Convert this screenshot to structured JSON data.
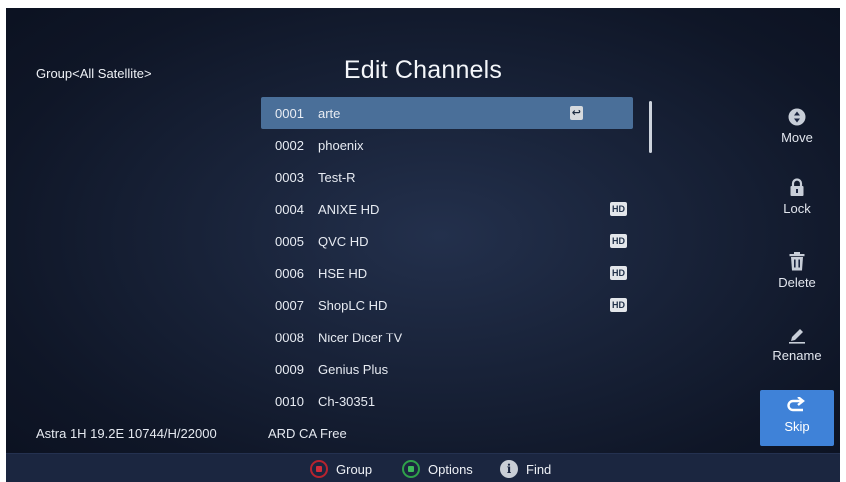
{
  "header": {
    "group": "Group<All Satellite>",
    "title": "Edit Channels"
  },
  "channels": [
    {
      "num": "0001",
      "name": "arte",
      "badge": "↩",
      "selected": true
    },
    {
      "num": "0002",
      "name": "phoenix",
      "badge": ""
    },
    {
      "num": "0003",
      "name": "Test-R",
      "badge": ""
    },
    {
      "num": "0004",
      "name": "ANIXE HD",
      "badge": "HD"
    },
    {
      "num": "0005",
      "name": "QVC HD",
      "badge": "HD"
    },
    {
      "num": "0006",
      "name": "HSE HD",
      "badge": "HD"
    },
    {
      "num": "0007",
      "name": "ShopLC HD",
      "badge": "HD"
    },
    {
      "num": "0008",
      "name": "Nicer Dicer TV",
      "badge": ""
    },
    {
      "num": "0009",
      "name": "Genius Plus",
      "badge": ""
    },
    {
      "num": "0010",
      "name": "Ch-30351",
      "badge": ""
    }
  ],
  "actions": {
    "move": "Move",
    "lock": "Lock",
    "delete": "Delete",
    "rename": "Rename",
    "skip": "Skip"
  },
  "status": {
    "satellite": "Astra 1H 19.2E  10744/H/22000",
    "channel_info": "ARD  CA Free"
  },
  "footer": {
    "red": "Group",
    "green": "Options",
    "info": "Find",
    "info_glyph": "i"
  },
  "colors": {
    "selected_row": "#4a6f99",
    "skip_button": "#3f82d8",
    "red_key": "#d12c39",
    "green_key": "#3dbb5a"
  }
}
